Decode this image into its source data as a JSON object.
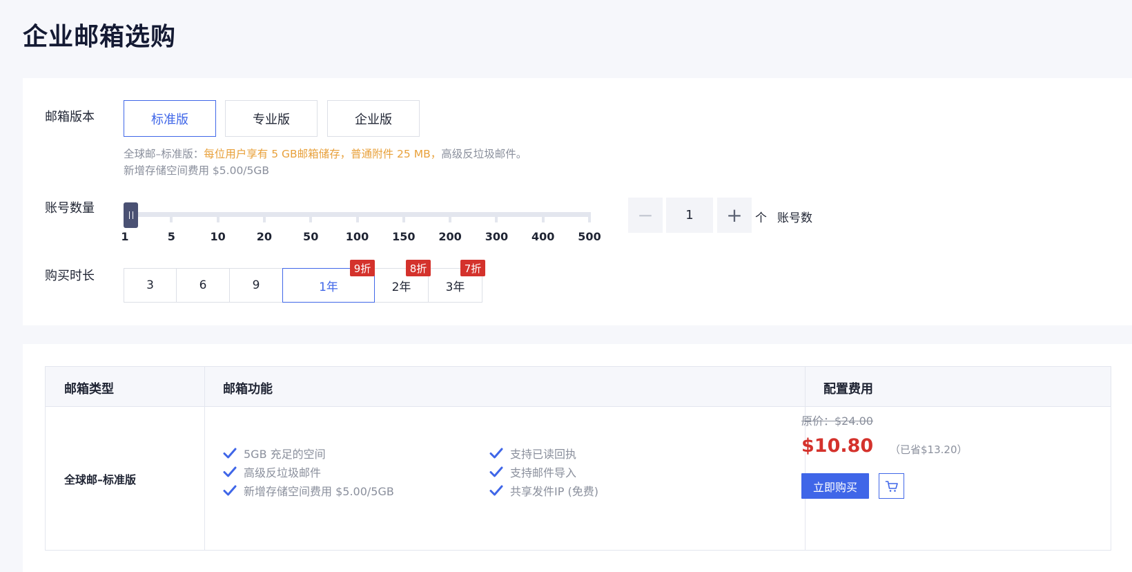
{
  "page": {
    "title": "企业邮箱选购"
  },
  "config": {
    "edition_label": "邮箱版本",
    "editions": [
      "标准版",
      "专业版",
      "企业版"
    ],
    "selected_edition": "标准版",
    "desc_prefix": "全球邮–标准版：",
    "desc_highlight": "每位用户享有 5 GB邮箱储存，普通附件 25 MB，",
    "desc_suffix": "高级反垃圾邮件。",
    "desc_line2": "新增存储空间费用 $5.00/5GB",
    "account_label": "账号数量",
    "slider_marks": [
      "1",
      "5",
      "10",
      "20",
      "50",
      "100",
      "150",
      "200",
      "300",
      "400",
      "500"
    ],
    "slider_value": 1,
    "stepper_minus": "−",
    "stepper_plus": "+",
    "account_count": "1",
    "unit": "个",
    "unit_label": "账号数",
    "duration_label": "购买时长",
    "durations": [
      "3",
      "6",
      "9",
      "1年",
      "2年",
      "3年"
    ],
    "selected_duration": "1年",
    "badges": [
      "9折",
      "8折",
      "7折"
    ]
  },
  "summary": {
    "headers": [
      "邮箱类型",
      "邮箱功能",
      "配置费用"
    ],
    "type_name": "全球邮–标准版",
    "features_left": [
      "5GB 充足的空间",
      "高级反垃圾邮件",
      "新增存储空间费用 $5.00/5GB"
    ],
    "features_right": [
      "支持已读回执",
      "支持邮件导入",
      "共享发件IP (免费)"
    ],
    "original_price": "原价：$24.00",
    "price": "$10.80",
    "saved": "（已省$13.20）",
    "buy_label": "立即购买",
    "cart_icon": "cart-icon"
  },
  "colors": {
    "accent": "#3f66e8",
    "price": "#d4322c",
    "highlight": "#e8a03a",
    "handle": "#4a5173"
  }
}
